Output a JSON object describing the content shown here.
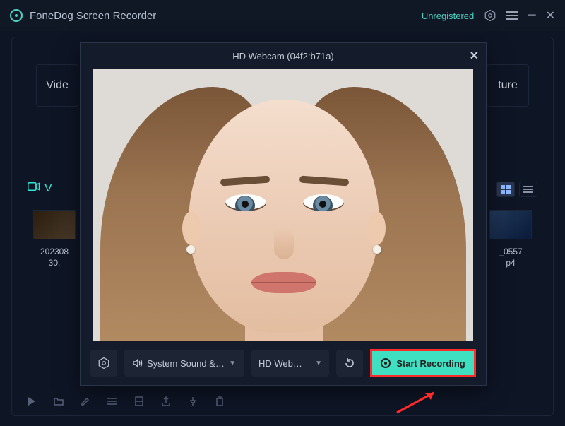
{
  "app": {
    "title": "FoneDog Screen Recorder",
    "status": "Unregistered"
  },
  "background": {
    "top_left_chip": "Vide",
    "top_right_chip": "ture",
    "tab_video_label": "V",
    "thumb_left_line1": "202308",
    "thumb_left_line2": "30.",
    "thumb_right_line1": "_0557",
    "thumb_right_line2": "p4"
  },
  "modal": {
    "title": "HD Webcam (04f2:b71a)",
    "audio_label": "System Sound &…",
    "camera_label": "HD Web…",
    "start_label": "Start Recording"
  }
}
